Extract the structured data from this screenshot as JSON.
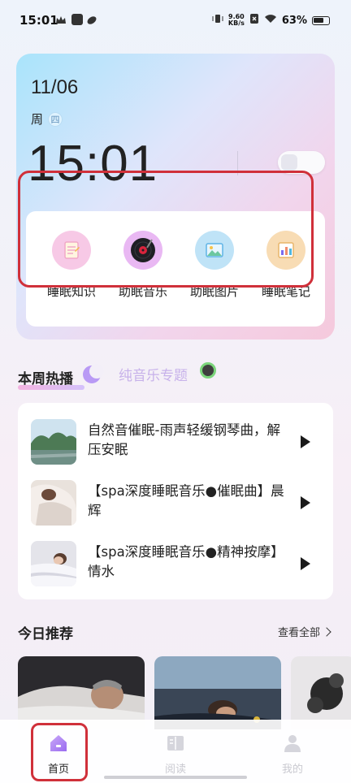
{
  "status_bar": {
    "time": "15:01",
    "net_speed_value": "9.60",
    "net_speed_unit": "KB/s",
    "battery": "63%"
  },
  "hero": {
    "date": "11/06",
    "week_prefix": "周",
    "week_day": "四",
    "clock": "15:01"
  },
  "tools": [
    {
      "label": "睡眠知识",
      "icon": "notepad-icon",
      "color": "#f7c9e6"
    },
    {
      "label": "助眠音乐",
      "icon": "vinyl-record-icon",
      "color": "#e9b8f3"
    },
    {
      "label": "助眠图片",
      "icon": "picture-icon",
      "color": "#bfe3f7"
    },
    {
      "label": "睡眠笔记",
      "icon": "chart-note-icon",
      "color": "#f8dcb4"
    }
  ],
  "section_tabs": {
    "active": "本周热播",
    "inactive": "纯音乐专题"
  },
  "hot_list": [
    {
      "title": "自然音催眠-雨声轻缓钢琴曲，解压安眠"
    },
    {
      "title": "【spa深度睡眠音乐●催眠曲】晨辉"
    },
    {
      "title": "【spa深度睡眠音乐●精神按摩】情水"
    }
  ],
  "today": {
    "title": "今日推荐",
    "view_all": "查看全部"
  },
  "nav": {
    "home": "首页",
    "read": "阅读",
    "mine": "我的"
  },
  "colors": {
    "accent_purple": "#a47bf0",
    "highlight_red": "#d0303a",
    "inactive_gray": "#c9c9d0"
  }
}
